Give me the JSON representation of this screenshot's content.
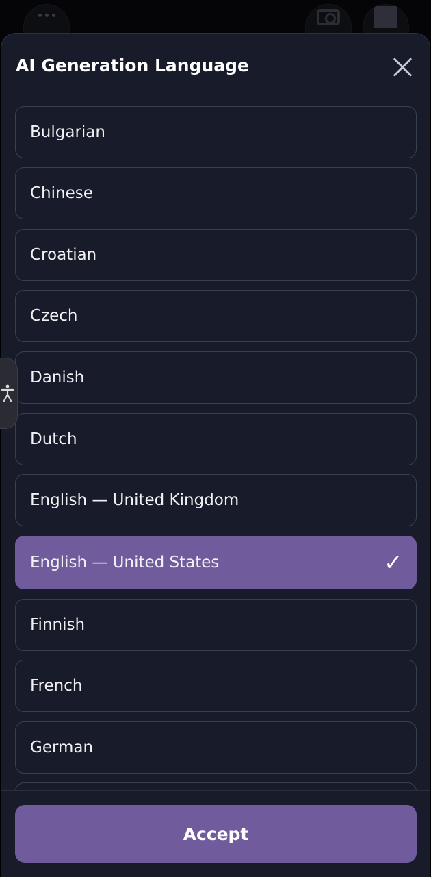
{
  "dialog": {
    "title": "AI Generation Language",
    "accept_label": "Accept"
  },
  "languages": [
    {
      "label": "Bulgarian",
      "selected": false
    },
    {
      "label": "Chinese",
      "selected": false
    },
    {
      "label": "Croatian",
      "selected": false
    },
    {
      "label": "Czech",
      "selected": false
    },
    {
      "label": "Danish",
      "selected": false
    },
    {
      "label": "Dutch",
      "selected": false
    },
    {
      "label": "English — United Kingdom",
      "selected": false
    },
    {
      "label": "English — United States",
      "selected": true
    },
    {
      "label": "Finnish",
      "selected": false
    },
    {
      "label": "French",
      "selected": false
    },
    {
      "label": "German",
      "selected": false
    },
    {
      "label": "",
      "selected": false
    }
  ],
  "icons": {
    "selected_mark": "✓",
    "close": "close-icon",
    "accessibility": "accessibility-icon"
  },
  "colors": {
    "sheet_bg": "#181b29",
    "accent": "#705c9c",
    "item_border": "#3b3f52"
  }
}
